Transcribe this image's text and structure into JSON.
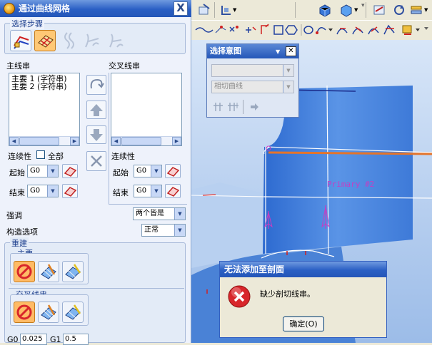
{
  "dialog": {
    "title": "通过曲线网格",
    "close_label": "X",
    "steps_label": "选择步骤",
    "primary_strings": {
      "label": "主线串",
      "items": [
        "主要 1 (字符串)",
        "主要 2 (字符串)"
      ],
      "continuity_label": "连续性",
      "all_label": "全部",
      "start_label": "起始",
      "start_value": "G0",
      "end_label": "结束",
      "end_value": "G0"
    },
    "cross_strings": {
      "label": "交叉线串",
      "items": [],
      "continuity_label": "连续性",
      "start_label": "起始",
      "start_value": "G0",
      "end_label": "结束",
      "end_value": "G0"
    },
    "emphasis_label": "强调",
    "emphasis_value": "两个皆是",
    "construction_label": "构造选项",
    "construction_value": "正常",
    "rebuild_label": "重建",
    "rebuild_primary_label": "主要",
    "rebuild_cross_label": "交叉线串",
    "g0_label": "G0",
    "g0_value": "0.025",
    "g1_label": "G1",
    "g1_value": "0.5"
  },
  "select_intent": {
    "title": "选择意图",
    "combo1_value": "",
    "combo2_value": "相切曲线"
  },
  "viewport": {
    "primary_label": "Primary #2"
  },
  "alert": {
    "title": "无法添加至剖面",
    "message": "缺少剖切线串。",
    "ok_label": "确定(O)"
  },
  "colors": {
    "title_bar": "#2a5fc4",
    "viewport_bg": "#a9c6ec",
    "surface": "#4f86d8",
    "highlight_curve": "#e4742b",
    "label_magenta": "#c33fc3",
    "error_red": "#d8262b"
  }
}
